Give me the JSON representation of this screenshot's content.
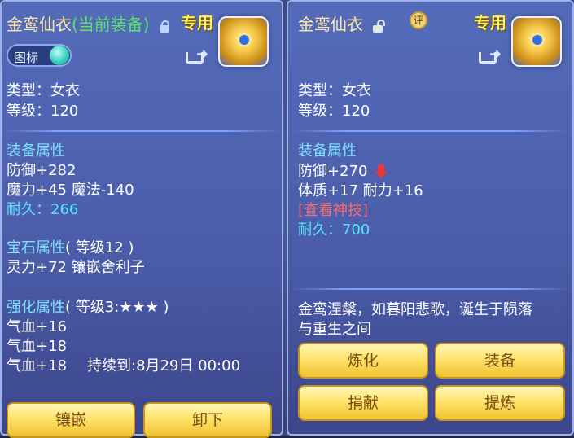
{
  "left": {
    "title": "金鸾仙衣",
    "status_tag": "(当前装备)",
    "exclusive": "专用",
    "toggle_label": "图标",
    "type": "类型：女衣",
    "level": "等级：120",
    "equip_attr_header": "装备属性",
    "defense": "防御+282",
    "magic": "魔力+45 魔法-140",
    "durability": "耐久：266",
    "gem_header": "宝石属性",
    "gem_level": "( 等级12 )",
    "gem_value": "灵力+72 镶嵌舍利子",
    "enhance_header": "强化属性",
    "enhance_level": "( 等级3:★★★ )",
    "hp1": "气血+16",
    "hp2": "气血+18",
    "hp3": "气血+18",
    "duration": "持续到:8月29日 00:00",
    "btn_inlay": "镶嵌",
    "btn_unequip": "卸下"
  },
  "right": {
    "title": "金鸾仙衣",
    "ping_label": "评",
    "exclusive": "专用",
    "type": "类型：女衣",
    "level": "等级：120",
    "equip_attr_header": "装备属性",
    "defense": "防御+270",
    "con_end": "体质+17 耐力+16",
    "skill_link": "[查看神技]",
    "durability": "耐久：700",
    "desc_line1": "金鸾涅槃，如暮阳悲歌，诞生于陨落",
    "desc_line2": "与重生之间",
    "btn_refine": "炼化",
    "btn_equip": "装备",
    "btn_donate": "捐献",
    "btn_extract": "提炼"
  },
  "colors": {
    "gold_button": "#ffe36b",
    "section_cyan": "#7fe0ff",
    "durability_cyan": "#55e6ff",
    "tag_green": "#59e36a",
    "link_red": "#ff6a6a"
  },
  "icons": [
    "lock-icon",
    "unlock-icon",
    "share-icon",
    "item-icon",
    "down-arrow-icon",
    "review-icon"
  ]
}
